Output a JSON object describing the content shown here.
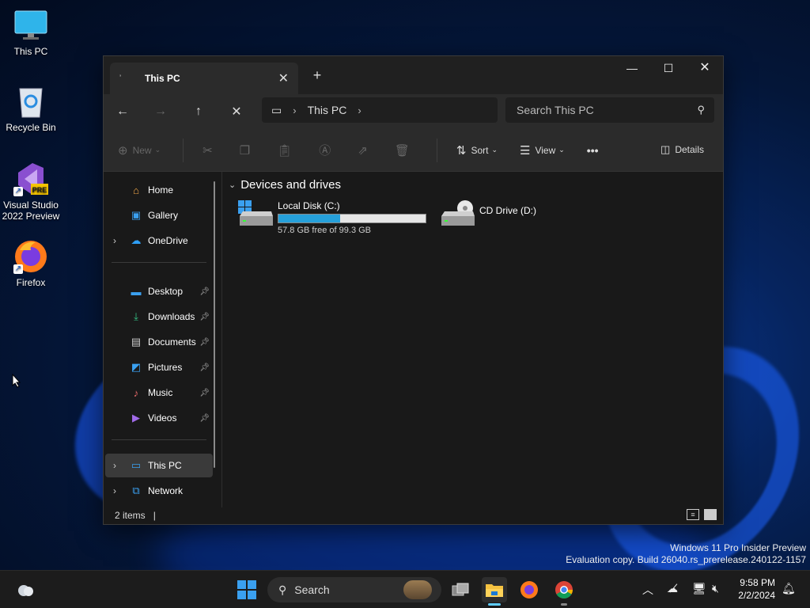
{
  "desktop": {
    "icons": [
      {
        "label": "This PC"
      },
      {
        "label": "Recycle Bin"
      },
      {
        "label": "Visual Studio 2022 Preview",
        "badge": "PRE"
      },
      {
        "label": "Firefox"
      }
    ],
    "watermark": {
      "line1": "Windows 11 Pro Insider Preview",
      "line2": "Evaluation copy. Build 26040.rs_prerelease.240122-1157"
    }
  },
  "window": {
    "tab_title": "This PC",
    "address": {
      "segments": [
        "This PC"
      ]
    },
    "search_placeholder": "Search This PC",
    "toolbar": {
      "new_label": "New",
      "sort_label": "Sort",
      "view_label": "View",
      "more_label": "•••",
      "details_label": "Details"
    },
    "nav": {
      "home": "Home",
      "gallery": "Gallery",
      "onedrive": "OneDrive",
      "desktop": "Desktop",
      "downloads": "Downloads",
      "documents": "Documents",
      "pictures": "Pictures",
      "music": "Music",
      "videos": "Videos",
      "this_pc": "This PC",
      "network": "Network"
    },
    "content": {
      "group_title": "Devices and drives",
      "drives": [
        {
          "name": "Local Disk (C:)",
          "free_text": "57.8 GB free of 99.3 GB",
          "used_fraction": 0.418
        },
        {
          "name": "CD Drive (D:)"
        }
      ]
    },
    "status": {
      "items": "2 items",
      "cursor": "|"
    }
  },
  "taskbar": {
    "search_label": "Search",
    "time": "9:58 PM",
    "date": "2/2/2024"
  },
  "colors": {
    "accent": "#60cdff",
    "drive_bar": "#26a0da",
    "window_bg": "#191919"
  }
}
